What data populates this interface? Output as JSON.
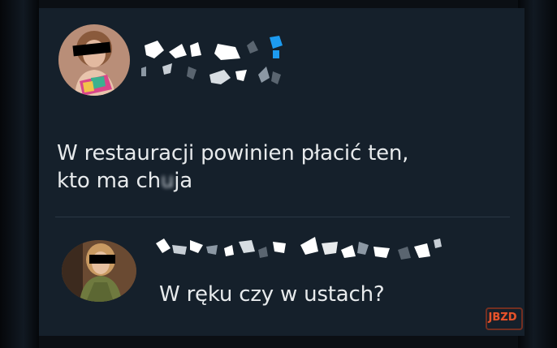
{
  "tweet": {
    "text_line1": "W restauracji powinien płacić ten,",
    "text_line2": "kto ma ch",
    "text_censor_glyph": "u",
    "text_line2_end": "ja",
    "author_name_icon": "pixelated-name-icon",
    "avatar_icon": "woman-avatar-icon"
  },
  "reply": {
    "text": "W ręku czy w ustach?",
    "author_name_icon": "pixelated-name-icon",
    "avatar_icon": "woman-avatar-icon"
  },
  "watermark": {
    "label": "JBZD"
  },
  "colors": {
    "background": "#15202b",
    "text": "#e7eaec",
    "divider": "#2a3744",
    "watermark": "#e5542c"
  }
}
